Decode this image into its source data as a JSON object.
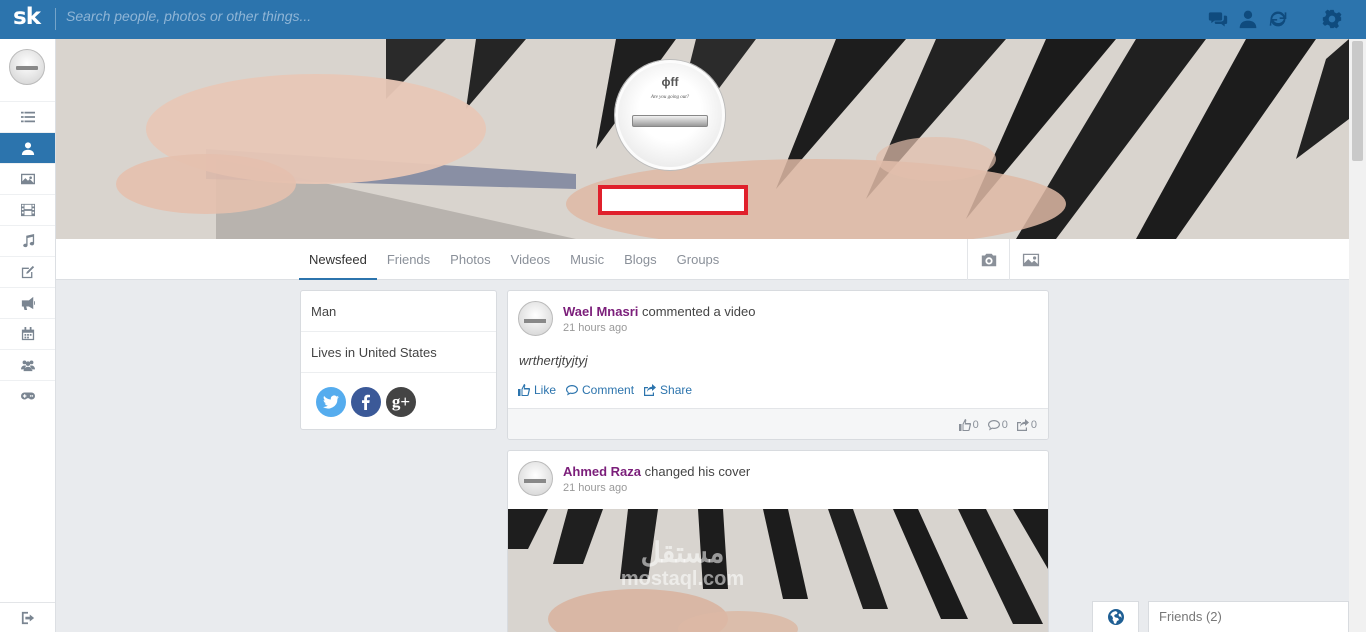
{
  "topbar": {
    "logo": "sk",
    "search_placeholder": "Search people, photos or other things...",
    "icons": [
      "chat-icon",
      "friend-requests-icon",
      "refresh-icon",
      "settings-icon"
    ]
  },
  "sidebar": {
    "items": [
      {
        "icon": "list-icon"
      },
      {
        "icon": "user-icon",
        "active": true
      },
      {
        "icon": "photo-icon"
      },
      {
        "icon": "film-icon"
      },
      {
        "icon": "music-icon"
      },
      {
        "icon": "edit-icon"
      },
      {
        "icon": "megaphone-icon"
      },
      {
        "icon": "calendar-icon"
      },
      {
        "icon": "group-icon"
      },
      {
        "icon": "gamepad-icon"
      }
    ],
    "bottom_icon": "logout-icon"
  },
  "profile": {
    "pic_brand": "ɸff",
    "pic_tagline": "Are you going out?",
    "name": ""
  },
  "tabs": [
    {
      "label": "Newsfeed",
      "active": true
    },
    {
      "label": "Friends"
    },
    {
      "label": "Photos"
    },
    {
      "label": "Videos"
    },
    {
      "label": "Music"
    },
    {
      "label": "Blogs"
    },
    {
      "label": "Groups"
    }
  ],
  "about": {
    "gender": "Man",
    "location": "Lives in United States",
    "socials": [
      {
        "name": "twitter",
        "color": "#55acee"
      },
      {
        "name": "facebook",
        "color": "#3b5998"
      },
      {
        "name": "google-plus",
        "color": "#444444",
        "glyph": "g+"
      }
    ]
  },
  "posts": [
    {
      "author": "Wael Mnasri",
      "action": "commented a video",
      "time": "21 hours ago",
      "text": "wrthertjtyjtyj",
      "actions": {
        "like": "Like",
        "comment": "Comment",
        "share": "Share"
      },
      "stats": {
        "likes": "0",
        "comments": "0",
        "shares": "0"
      }
    },
    {
      "author": "Ahmed Raza",
      "action": "changed his cover",
      "time": "21 hours ago"
    }
  ],
  "watermark": {
    "arabic": "مستقل",
    "latin": "mostaql.com"
  },
  "chat": {
    "friends_label": "Friends (2)"
  },
  "colors": {
    "brand_blue": "#2c74ad",
    "author_purple": "#7b1e7a",
    "highlight_red": "#e0202b"
  }
}
